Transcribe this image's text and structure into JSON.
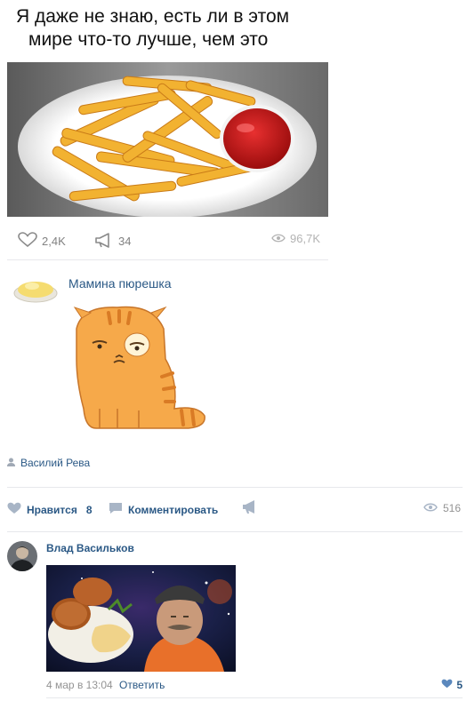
{
  "caption": {
    "line1": "Я даже не знаю, есть ли в этом",
    "line2": "мире что-то лучше, чем это"
  },
  "post": {
    "image_alt": "fries-with-ketchup-photo",
    "stats": {
      "likes": "2,4K",
      "shares": "34",
      "views": "96,7K"
    }
  },
  "comment1": {
    "author": "Мамина пюрешка",
    "sticker": "sad-orange-cat-sticker"
  },
  "post_author": {
    "name": "Василий Рева"
  },
  "actions": {
    "like_label": "Нравится",
    "like_count": "8",
    "comment_label": "Комментировать",
    "views": "516"
  },
  "comment2": {
    "author": "Влад Васильков",
    "image_alt": "cutlets-with-pasta-and-man-in-hat-photo",
    "date": "4 мар в 13:04",
    "reply_label": "Ответить",
    "likes": "5"
  },
  "colors": {
    "link": "#2a5885",
    "muted": "#939393",
    "divider": "#e7e8ec"
  }
}
